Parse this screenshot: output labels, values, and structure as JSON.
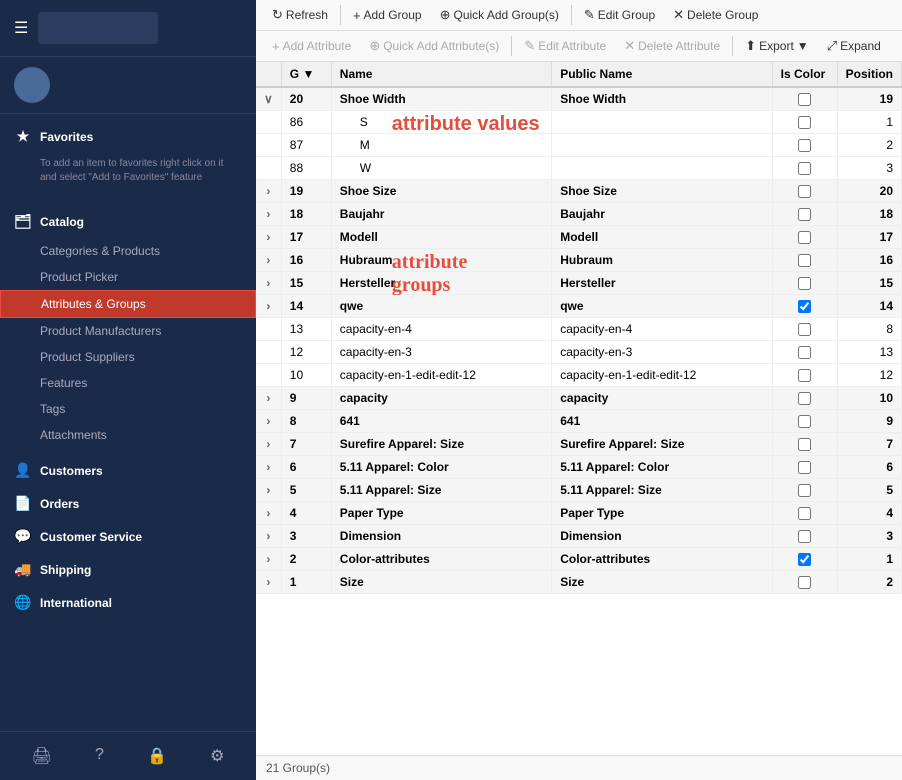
{
  "sidebar": {
    "hamburger": "☰",
    "user": {
      "name": "",
      "role": ""
    },
    "favorites": {
      "label": "Favorites",
      "note": "To add an item to favorites right click on it and select \"Add to Favorites\" feature"
    },
    "catalog": {
      "label": "Catalog",
      "items": [
        {
          "id": "categories-products",
          "label": "Categories & Products"
        },
        {
          "id": "product-picker",
          "label": "Product Picker"
        },
        {
          "id": "attributes-groups",
          "label": "Attributes & Groups",
          "active": true
        },
        {
          "id": "product-manufacturers",
          "label": "Product Manufacturers"
        },
        {
          "id": "product-suppliers",
          "label": "Product Suppliers"
        },
        {
          "id": "features",
          "label": "Features"
        },
        {
          "id": "tags",
          "label": "Tags"
        },
        {
          "id": "attachments",
          "label": "Attachments"
        }
      ]
    },
    "customers": {
      "label": "Customers"
    },
    "orders": {
      "label": "Orders"
    },
    "customer-service": {
      "label": "Customer Service"
    },
    "shipping": {
      "label": "Shipping"
    },
    "international": {
      "label": "International"
    },
    "bottom_icons": [
      "⚙",
      "?",
      "🔒",
      "⚙"
    ]
  },
  "toolbar1": {
    "refresh": "Refresh",
    "add_group": "Add Group",
    "quick_add_groups": "Quick Add Group(s)",
    "edit_group": "Edit Group",
    "delete_group": "Delete Group"
  },
  "toolbar2": {
    "add_attribute": "Add Attribute",
    "quick_add_attributes": "Quick Add Attribute(s)",
    "edit_attribute": "Edit Attribute",
    "delete_attribute": "Delete Attribute",
    "export": "Export",
    "expand": "Expand"
  },
  "table": {
    "headers": [
      "",
      "G",
      "Name",
      "Public Name",
      "Is Color",
      "Position"
    ],
    "rows": [
      {
        "type": "group",
        "g": "20",
        "name": "Shoe Width",
        "pubname": "Shoe Width",
        "iscolor": false,
        "pos": "19",
        "expanded": true,
        "children": [
          {
            "g": "86",
            "name": "S",
            "pubname": "",
            "iscolor": false,
            "pos": "1"
          },
          {
            "g": "87",
            "name": "M",
            "pubname": "",
            "iscolor": false,
            "pos": "2"
          },
          {
            "g": "88",
            "name": "W",
            "pubname": "",
            "iscolor": false,
            "pos": "3"
          }
        ]
      },
      {
        "type": "group",
        "g": "19",
        "name": "Shoe Size",
        "pubname": "Shoe Size",
        "iscolor": false,
        "pos": "20"
      },
      {
        "type": "group",
        "g": "18",
        "name": "Baujahr",
        "pubname": "Baujahr",
        "iscolor": false,
        "pos": "18"
      },
      {
        "type": "group",
        "g": "17",
        "name": "Modell",
        "pubname": "Modell",
        "iscolor": false,
        "pos": "17"
      },
      {
        "type": "group",
        "g": "16",
        "name": "Hubraum",
        "pubname": "Hubraum",
        "iscolor": false,
        "pos": "16"
      },
      {
        "type": "group",
        "g": "15",
        "name": "Hersteller",
        "pubname": "Hersteller",
        "iscolor": false,
        "pos": "15"
      },
      {
        "type": "group",
        "g": "14",
        "name": "qwe",
        "pubname": "qwe",
        "iscolor": true,
        "pos": "14"
      },
      {
        "type": "flat",
        "g": "13",
        "name": "capacity-en-4",
        "pubname": "capacity-en-4",
        "iscolor": false,
        "pos": "8"
      },
      {
        "type": "flat",
        "g": "12",
        "name": "capacity-en-3",
        "pubname": "capacity-en-3",
        "iscolor": false,
        "pos": "13"
      },
      {
        "type": "flat",
        "g": "10",
        "name": "capacity-en-1-edit-edit-12",
        "pubname": "capacity-en-1-edit-edit-12",
        "iscolor": false,
        "pos": "12"
      },
      {
        "type": "group",
        "g": "9",
        "name": "capacity",
        "pubname": "capacity",
        "iscolor": false,
        "pos": "10"
      },
      {
        "type": "group",
        "g": "8",
        "name": "641",
        "pubname": "641",
        "iscolor": false,
        "pos": "9"
      },
      {
        "type": "group",
        "g": "7",
        "name": "Surefire Apparel: Size",
        "pubname": "Surefire Apparel: Size",
        "iscolor": false,
        "pos": "7"
      },
      {
        "type": "group",
        "g": "6",
        "name": "5.11 Apparel: Color",
        "pubname": "5.11 Apparel: Color",
        "iscolor": false,
        "pos": "6"
      },
      {
        "type": "group",
        "g": "5",
        "name": "5.11 Apparel: Size",
        "pubname": "5.11 Apparel: Size",
        "iscolor": false,
        "pos": "5"
      },
      {
        "type": "group",
        "g": "4",
        "name": "Paper Type",
        "pubname": "Paper Type",
        "iscolor": false,
        "pos": "4"
      },
      {
        "type": "group",
        "g": "3",
        "name": "Dimension",
        "pubname": "Dimension",
        "iscolor": false,
        "pos": "3"
      },
      {
        "type": "group",
        "g": "2",
        "name": "Color-attributes",
        "pubname": "Color-attributes",
        "iscolor": true,
        "pos": "1"
      },
      {
        "type": "group",
        "g": "1",
        "name": "Size",
        "pubname": "Size",
        "iscolor": false,
        "pos": "2"
      }
    ],
    "footer": "21 Group(s)"
  },
  "annotations": {
    "values": "attribute values",
    "groups": "attribute\ngroups"
  },
  "icons": {
    "refresh": "↻",
    "add": "+",
    "quick_add": "⊕",
    "edit": "✎",
    "delete": "✕",
    "export": "⬆",
    "expand": "⤢",
    "chevron_right": "›",
    "chevron_down": "∨",
    "star": "★",
    "info": "ℹ",
    "catalog": "📋",
    "customers": "👤",
    "orders": "📄",
    "customer_service": "💬",
    "shipping": "🚚",
    "international": "🌐"
  }
}
